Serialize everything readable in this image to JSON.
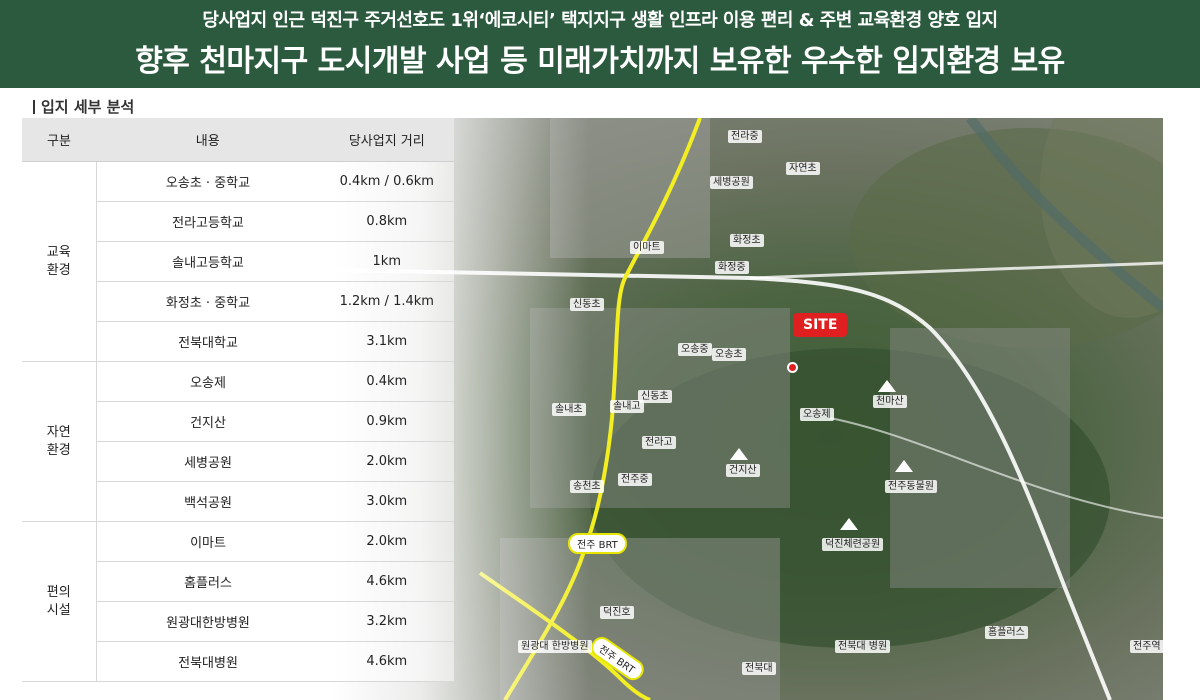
{
  "header": {
    "line1": "당사업지 인근 덕진구 주거선호도 1위‘에코시티’ 택지지구 생활 인프라 이용 편리 & 주변 교육환경 양호 입지",
    "line2": "향후 천마지구 도시개발 사업 등 미래가치까지 보유한 우수한 입지환경 보유"
  },
  "section_title": "입지 세부 분석",
  "table": {
    "headers": [
      "구분",
      "내용",
      "당사업지 거리"
    ],
    "groups": [
      {
        "category": [
          "교육",
          "환경"
        ],
        "rows": [
          {
            "name": "오송초 · 중학교",
            "distance": "0.4km / 0.6km"
          },
          {
            "name": "전라고등학교",
            "distance": "0.8km"
          },
          {
            "name": "솔내고등학교",
            "distance": "1km"
          },
          {
            "name": "화정초 · 중학교",
            "distance": "1.2km / 1.4km"
          },
          {
            "name": "전북대학교",
            "distance": "3.1km"
          }
        ]
      },
      {
        "category": [
          "자연",
          "환경"
        ],
        "rows": [
          {
            "name": "오송제",
            "distance": "0.4km"
          },
          {
            "name": "건지산",
            "distance": "0.9km"
          },
          {
            "name": "세병공원",
            "distance": "2.0km"
          },
          {
            "name": "백석공원",
            "distance": "3.0km"
          }
        ]
      },
      {
        "category": [
          "편의",
          "시설"
        ],
        "rows": [
          {
            "name": "이마트",
            "distance": "2.0km"
          },
          {
            "name": "홈플러스",
            "distance": "4.6km"
          },
          {
            "name": "원광대한방병원",
            "distance": "3.2km"
          },
          {
            "name": "전북대병원",
            "distance": "4.6km"
          }
        ]
      }
    ]
  },
  "map": {
    "site_label": "SITE",
    "brt_labels": [
      "전주 BRT",
      "전주 BRT"
    ],
    "place_labels": [
      "세병공원",
      "화정초",
      "화정중",
      "이마트",
      "자연초",
      "전라중",
      "신동초",
      "오송중",
      "오송초",
      "신동초",
      "솔내고",
      "전라고",
      "건지산",
      "오송제",
      "천마산",
      "송천초",
      "전주중",
      "전주동물원",
      "덕진체련공원",
      "덕진호",
      "원광대 한방병원",
      "전북대",
      "전북대 병원",
      "홈플러스",
      "전주역",
      "솔내초"
    ]
  },
  "colors": {
    "header_bg": "#2b5a3f",
    "site_red": "#e02020",
    "road_yellow": "#f2ee22"
  }
}
